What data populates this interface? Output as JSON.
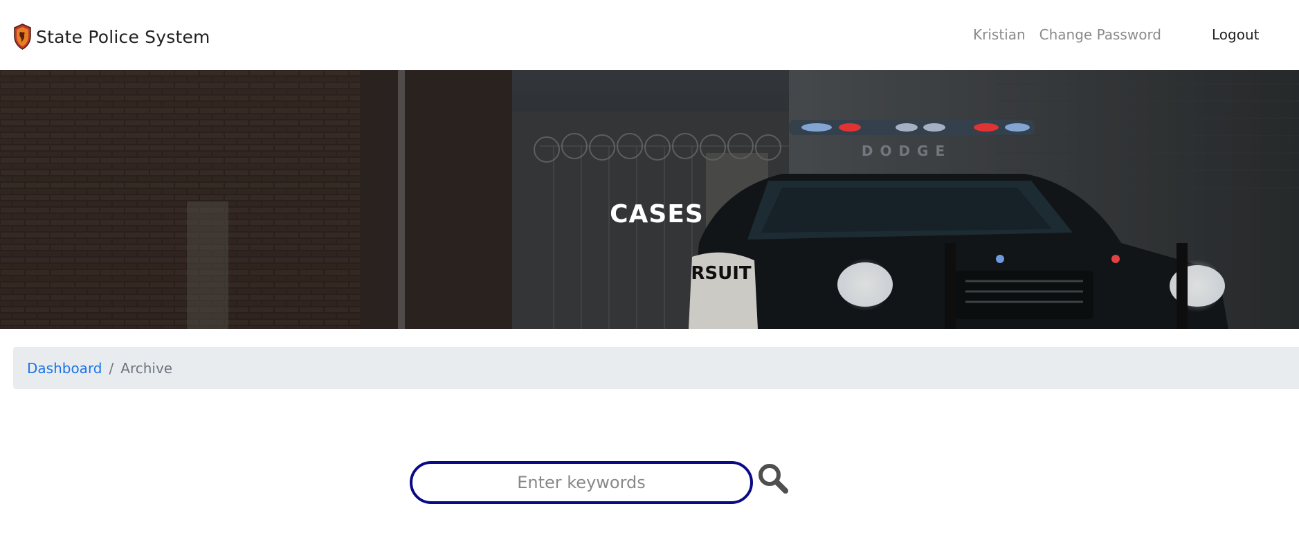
{
  "navbar": {
    "brand_name": "State Police System",
    "user_name": "Kristian",
    "change_password_label": "Change Password",
    "logout_label": "Logout"
  },
  "hero": {
    "title": "CASES"
  },
  "breadcrumb": {
    "items": [
      {
        "label": "Dashboard",
        "link": true
      },
      {
        "label": "Archive",
        "link": false
      }
    ],
    "separator": "/"
  },
  "search": {
    "placeholder": "Enter keywords",
    "value": "",
    "icon": "search-icon"
  },
  "colors": {
    "accent_link": "#1a73e8",
    "search_border": "#0a0a87",
    "breadcrumb_bg": "#e9ecef"
  }
}
